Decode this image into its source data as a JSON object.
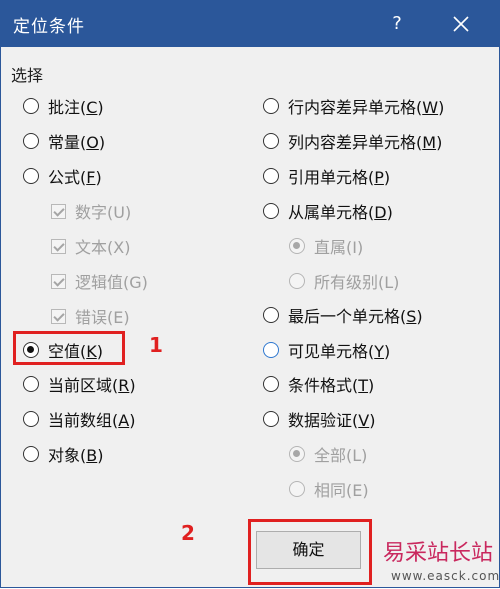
{
  "dialog": {
    "title": "定位条件",
    "help": "?"
  },
  "section_label": "选择",
  "left_options": [
    {
      "pre": "批注(",
      "key": "C",
      "post": ")"
    },
    {
      "pre": "常量(",
      "key": "O",
      "post": ")"
    },
    {
      "pre": "公式(",
      "key": "F",
      "post": ")"
    },
    {
      "pre": "数字(U)"
    },
    {
      "pre": "文本(X)"
    },
    {
      "pre": "逻辑值(G)"
    },
    {
      "pre": "错误(E)"
    },
    {
      "pre": "空值(",
      "key": "K",
      "post": ")"
    },
    {
      "pre": "当前区域(",
      "key": "R",
      "post": ")"
    },
    {
      "pre": "当前数组(",
      "key": "A",
      "post": ")"
    },
    {
      "pre": "对象(",
      "key": "B",
      "post": ")"
    }
  ],
  "right_options": [
    {
      "pre": "行内容差异单元格(",
      "key": "W",
      "post": ")"
    },
    {
      "pre": "列内容差异单元格(",
      "key": "M",
      "post": ")"
    },
    {
      "pre": "引用单元格(",
      "key": "P",
      "post": ")"
    },
    {
      "pre": "从属单元格(",
      "key": "D",
      "post": ")"
    },
    {
      "pre": "直属(I)"
    },
    {
      "pre": "所有级别(L)"
    },
    {
      "pre": "最后一个单元格(",
      "key": "S",
      "post": ")"
    },
    {
      "pre": "可见单元格(",
      "key": "Y",
      "post": ")"
    },
    {
      "pre": "条件格式(",
      "key": "T",
      "post": ")"
    },
    {
      "pre": "数据验证(",
      "key": "V",
      "post": ")"
    },
    {
      "pre": "全部(L)"
    },
    {
      "pre": "相同(E)"
    }
  ],
  "ok_button": "确定",
  "annotations": {
    "step1": "1",
    "step2": "2"
  },
  "watermark": {
    "title": "易采站长站",
    "url": "www.easck.com"
  },
  "colors": {
    "titlebar": "#2b579a",
    "highlight": "#e02020",
    "watermark": "#c9285e"
  }
}
